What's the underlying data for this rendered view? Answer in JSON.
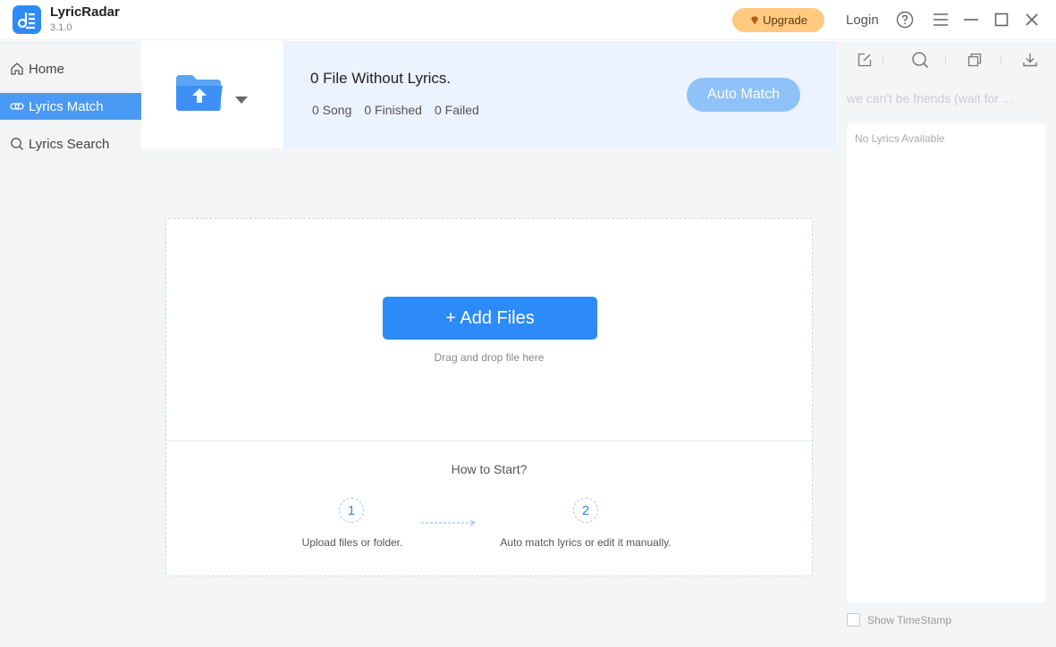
{
  "app": {
    "name": "LyricRadar",
    "version": "3.1.0"
  },
  "titlebar": {
    "upgrade_label": "Upgrade",
    "login_label": "Login"
  },
  "sidebar": {
    "items": [
      {
        "label": "Home",
        "icon": "home-icon",
        "active": false
      },
      {
        "label": "Lyrics Match",
        "icon": "link-icon",
        "active": true
      },
      {
        "label": "Lyrics Search",
        "icon": "search-icon",
        "active": false
      }
    ]
  },
  "main": {
    "info_title": "0 File Without Lyrics.",
    "stats": {
      "song": "0 Song",
      "finished": "0 Finished",
      "failed": "0 Failed"
    },
    "auto_match_label": "Auto Match",
    "add_files_label": "+ Add Files",
    "drag_hint": "Drag and drop file here",
    "how_to_start": "How to Start?",
    "steps": [
      {
        "number": "1",
        "text": "Upload files or folder."
      },
      {
        "number": "2",
        "text": "Auto match lyrics or edit it manually."
      }
    ]
  },
  "right_panel": {
    "song_title": "we can't be friends (wait for ...",
    "no_lyrics": "No Lyrics Available",
    "show_timestamp": "Show TimeStamp",
    "show_timestamp_checked": false
  },
  "colors": {
    "accent": "#2d8bf7",
    "active_nav": "#4a9af5",
    "upgrade": "#ffc980",
    "auto_match_disabled": "#8ec2f8",
    "info_bar": "#eaf3fe"
  }
}
